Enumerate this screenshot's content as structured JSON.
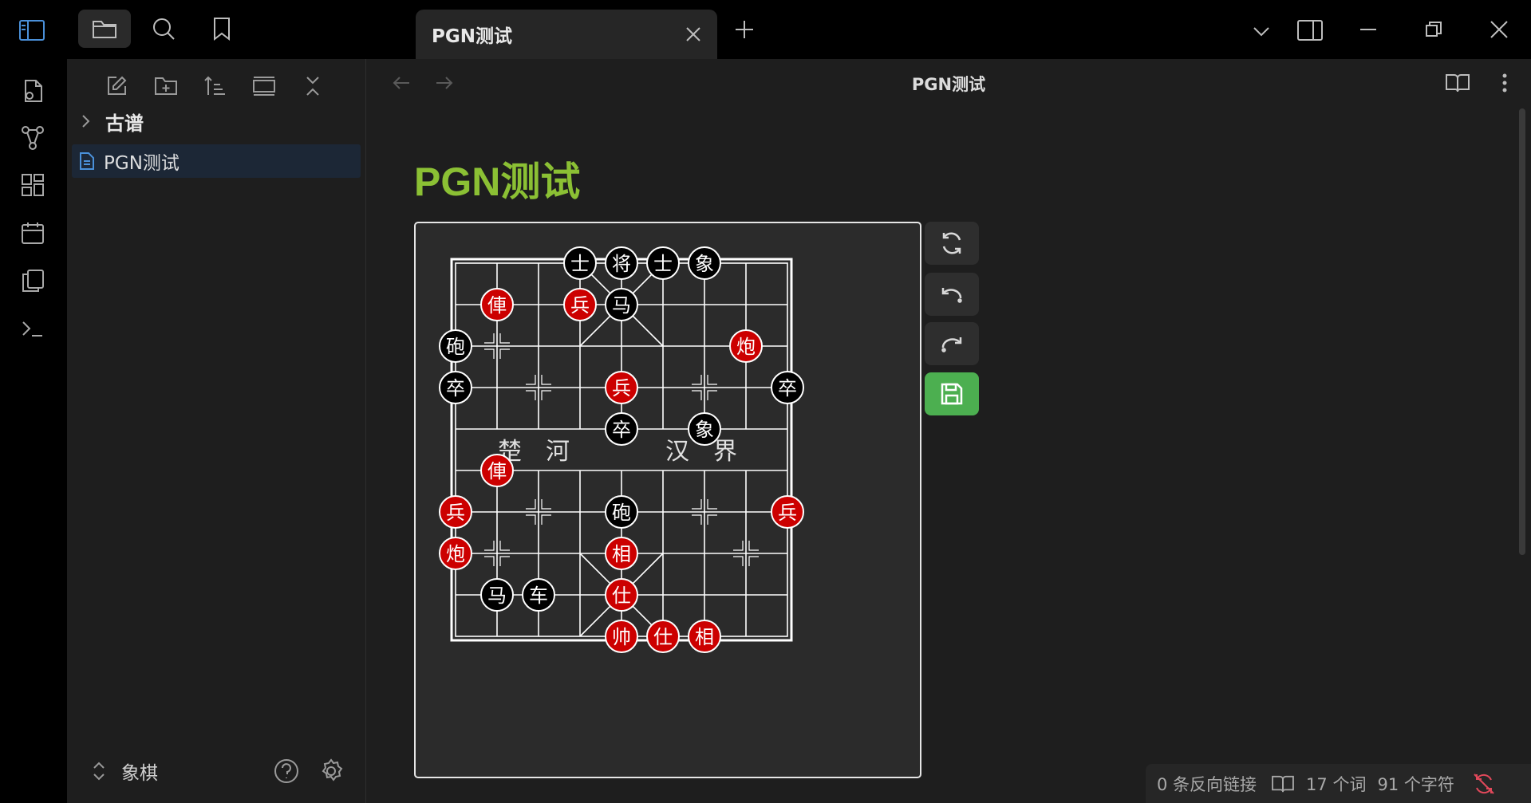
{
  "tab": {
    "title": "PGN测试",
    "close_glyph": "✕"
  },
  "sidebar": {
    "folder": "古谱",
    "file": "PGN测试",
    "vault": "象棋"
  },
  "main": {
    "view_title": "PGN测试",
    "doc_title": "PGN测试"
  },
  "board": {
    "river_left": "楚　河",
    "river_right": "汉　界",
    "pieces": [
      {
        "file": 3,
        "rank": 0,
        "t": "士",
        "side": "black"
      },
      {
        "file": 4,
        "rank": 0,
        "t": "将",
        "side": "black"
      },
      {
        "file": 5,
        "rank": 0,
        "t": "士",
        "side": "black"
      },
      {
        "file": 6,
        "rank": 0,
        "t": "象",
        "side": "black"
      },
      {
        "file": 1,
        "rank": 1,
        "t": "俥",
        "side": "red"
      },
      {
        "file": 3,
        "rank": 1,
        "t": "兵",
        "side": "red"
      },
      {
        "file": 4,
        "rank": 1,
        "t": "马",
        "side": "black"
      },
      {
        "file": 0,
        "rank": 2,
        "t": "砲",
        "side": "black"
      },
      {
        "file": 7,
        "rank": 2,
        "t": "炮",
        "side": "red"
      },
      {
        "file": 0,
        "rank": 3,
        "t": "卒",
        "side": "black"
      },
      {
        "file": 4,
        "rank": 3,
        "t": "兵",
        "side": "red"
      },
      {
        "file": 8,
        "rank": 3,
        "t": "卒",
        "side": "black"
      },
      {
        "file": 4,
        "rank": 4,
        "t": "卒",
        "side": "black"
      },
      {
        "file": 6,
        "rank": 4,
        "t": "象",
        "side": "black"
      },
      {
        "file": 1,
        "rank": 5,
        "t": "俥",
        "side": "red"
      },
      {
        "file": 0,
        "rank": 6,
        "t": "兵",
        "side": "red"
      },
      {
        "file": 4,
        "rank": 6,
        "t": "砲",
        "side": "black"
      },
      {
        "file": 8,
        "rank": 6,
        "t": "兵",
        "side": "red"
      },
      {
        "file": 0,
        "rank": 7,
        "t": "炮",
        "side": "red"
      },
      {
        "file": 4,
        "rank": 7,
        "t": "相",
        "side": "red"
      },
      {
        "file": 1,
        "rank": 8,
        "t": "马",
        "side": "black"
      },
      {
        "file": 2,
        "rank": 8,
        "t": "车",
        "side": "black"
      },
      {
        "file": 4,
        "rank": 8,
        "t": "仕",
        "side": "red"
      },
      {
        "file": 4,
        "rank": 9,
        "t": "帅",
        "side": "red"
      },
      {
        "file": 5,
        "rank": 9,
        "t": "仕",
        "side": "red"
      },
      {
        "file": 6,
        "rank": 9,
        "t": "相",
        "side": "red"
      }
    ],
    "markers": [
      [
        1,
        2
      ],
      [
        2,
        3
      ],
      [
        6,
        3
      ],
      [
        2,
        6
      ],
      [
        6,
        6
      ],
      [
        1,
        7
      ],
      [
        7,
        7
      ]
    ]
  },
  "controls": [
    "refresh-icon",
    "undo-icon",
    "redo-icon",
    "save-icon"
  ],
  "status": {
    "backlinks": "0 条反向链接",
    "words": "17 个词",
    "chars": "91 个字符"
  },
  "colors": {
    "accent": "#8bc034",
    "red_piece": "#cc0000",
    "black_piece": "#000000",
    "save_button": "#4caf50"
  }
}
